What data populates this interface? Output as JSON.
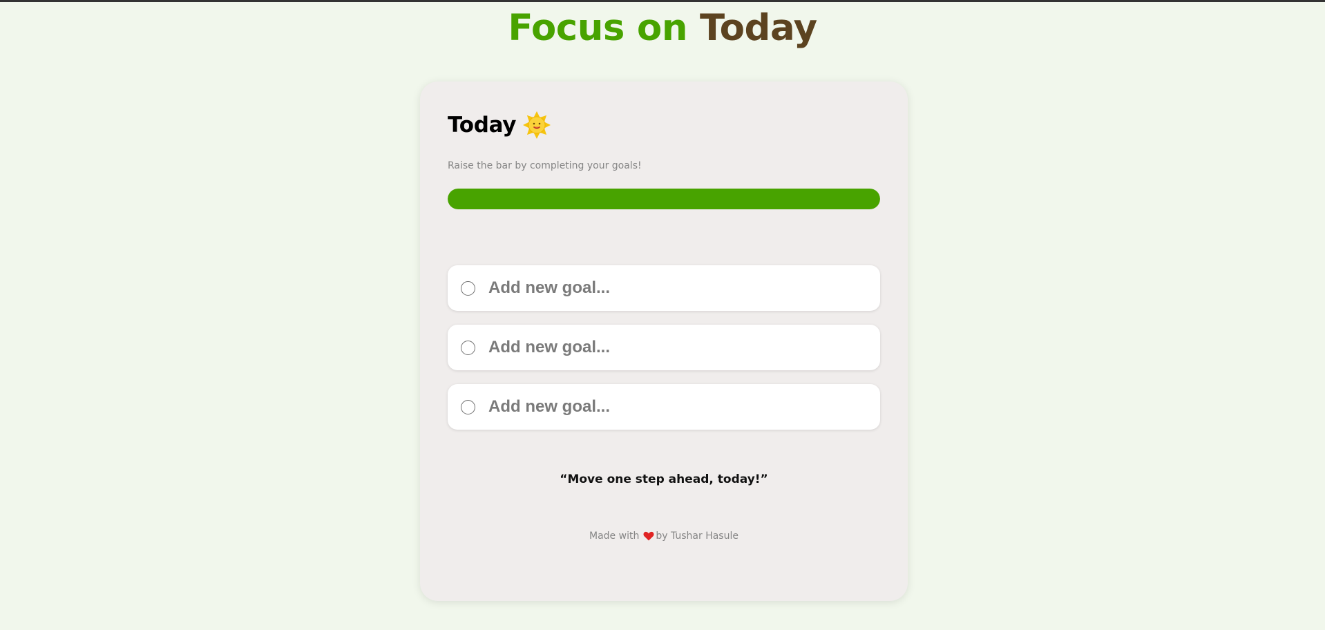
{
  "app_title": {
    "part1": "Focus on",
    "part2": "Today"
  },
  "card": {
    "heading": "Today",
    "heading_icon": "sun-icon",
    "subtitle": "Raise the bar by completing your goals!",
    "progress": {
      "fraction": 1.0
    },
    "goals": [
      {
        "placeholder": "Add new goal...",
        "value": "",
        "completed": false
      },
      {
        "placeholder": "Add new goal...",
        "value": "",
        "completed": false
      },
      {
        "placeholder": "Add new goal...",
        "value": "",
        "completed": false
      }
    ],
    "quote": "“Move one step ahead, today!”",
    "footer": {
      "prefix": "Made with",
      "icon": "heart-icon",
      "suffix": "by Tushar Hasule"
    }
  },
  "colors": {
    "background": "#f1f7ec",
    "accent_green": "#48a300",
    "accent_brown": "#5c4320",
    "card": "#f0edec"
  }
}
